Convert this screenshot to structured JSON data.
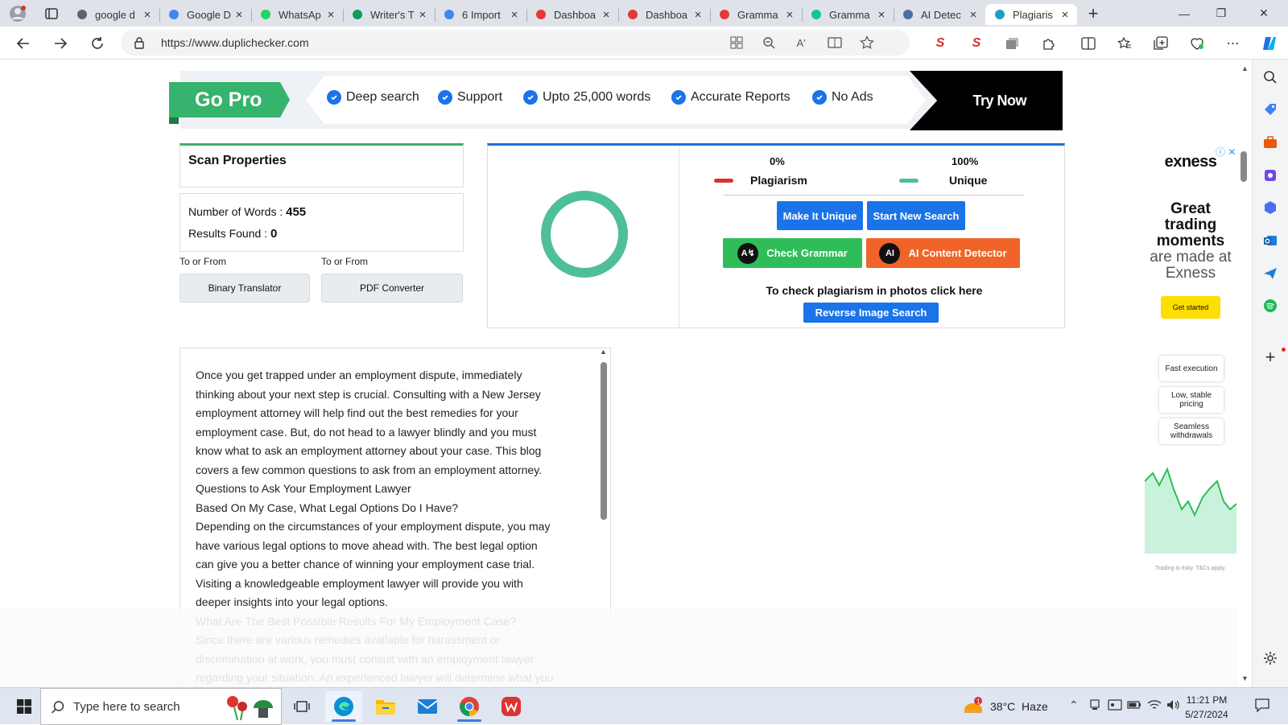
{
  "browser": {
    "tabs": [
      {
        "title": "google d",
        "icon": "search-icon",
        "color": "#5f6368"
      },
      {
        "title": "Google D",
        "icon": "docs-icon",
        "color": "#4285f4"
      },
      {
        "title": "WhatsAp",
        "icon": "whatsapp-icon",
        "color": "#25d366"
      },
      {
        "title": "Writer's T",
        "icon": "sheets-icon",
        "color": "#0f9d58"
      },
      {
        "title": "6 Import",
        "icon": "docs-icon",
        "color": "#4285f4"
      },
      {
        "title": "Dashboa",
        "icon": "s-logo-icon",
        "color": "#e53935"
      },
      {
        "title": "Dashboa",
        "icon": "s-logo-icon",
        "color": "#e53935"
      },
      {
        "title": "Gramma",
        "icon": "s-logo-icon",
        "color": "#e53935"
      },
      {
        "title": "Gramma",
        "icon": "grammarly-icon",
        "color": "#15c39a"
      },
      {
        "title": "AI Detec",
        "icon": "globe-icon",
        "color": "#4a6fa5"
      },
      {
        "title": "Plagiaris",
        "icon": "duplichecker-icon",
        "color": "#1fa0c8",
        "active": true
      }
    ],
    "url": "https://www.duplichecker.com"
  },
  "promo": {
    "gopro": "Go Pro",
    "features": [
      "Deep search",
      "Support",
      "Upto 25,000 words",
      "Accurate Reports",
      "No Ads"
    ],
    "try_now": "Try Now"
  },
  "scan": {
    "title": "Scan Properties",
    "words_label": "Number of Words : ",
    "words_value": "455",
    "results_label": "Results Found : ",
    "results_value": "0",
    "tofrom1": "To or From",
    "tofrom2": "To or From",
    "binary": "Binary Translator",
    "pdf": "PDF Converter"
  },
  "results": {
    "plag_pct": "0%",
    "plag_label": "Plagiarism",
    "unique_pct": "100%",
    "unique_label": "Unique",
    "plagiarism_fraction": 0.0,
    "unique_fraction": 1.0,
    "make_unique": "Make It Unique",
    "new_search": "Start New Search",
    "check_grammar": "Check Grammar",
    "ai_detector": "AI Content Detector",
    "photo_text": "To check plagiarism in photos click here",
    "reverse_image": "Reverse Image Search",
    "colors": {
      "plagiarism": "#e03131",
      "unique": "#4fbf97",
      "blue_btn": "#1a73e8",
      "green_btn": "#2ebd59",
      "orange_btn": "#f0642a"
    }
  },
  "text_lines": [
    "Once you get trapped under an employment dispute, immediately",
    "thinking about your next step is crucial. Consulting with a New Jersey",
    "employment attorney will help find out the best remedies for your",
    "employment case. But, do not head to a lawyer blindly and you must",
    "know what to ask an employment attorney about your case. This blog",
    "covers a few common questions to ask from an employment attorney.",
    "Questions to Ask Your Employment Lawyer",
    "Based On My Case, What Legal Options Do I Have?",
    "Depending on the circumstances of your employment dispute, you may",
    "have various legal options to move ahead with. The best legal option",
    "can give you a better chance of winning your employment case trial.",
    "Visiting a knowledgeable employment lawyer will provide you with",
    "deeper insights into your legal options.",
    "What Are The Best Possible Results For My Employment Case?",
    "Since there are various remedies available for harassment or",
    "discrimination at work, you must consult with an employment lawyer",
    "regarding your situation. An experienced lawyer will determine what you"
  ],
  "ad": {
    "brand": "exness",
    "headline": "Great trading moments",
    "headline2": "are made at Exness",
    "cta": "Get started",
    "features": [
      "Fast execution",
      "Low, stable pricing",
      "Seamless withdrawals"
    ],
    "disclaimer": "Trading is risky. T&Cs apply."
  },
  "taskbar": {
    "search_placeholder": "Type here to search",
    "weather": "38°C  Haze",
    "time": "11:21 PM",
    "date": "5/27/2024"
  }
}
